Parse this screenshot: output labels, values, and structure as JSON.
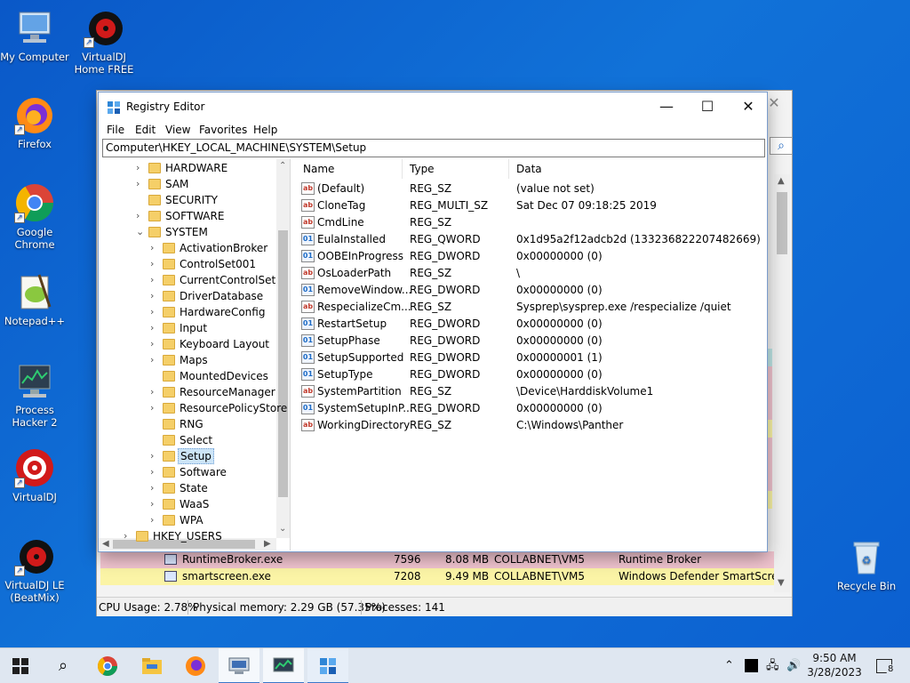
{
  "desktop_icons": [
    {
      "label": "My Computer",
      "icon": "my-computer-icon"
    },
    {
      "label": "VirtualDJ Home FREE",
      "icon": "virtualdj-home-icon"
    },
    {
      "label": "Firefox",
      "icon": "firefox-icon"
    },
    {
      "label": "Google Chrome",
      "icon": "chrome-icon"
    },
    {
      "label": "Notepad++",
      "icon": "notepadpp-icon"
    },
    {
      "label": "Process Hacker 2",
      "icon": "process-hacker-icon"
    },
    {
      "label": "VirtualDJ",
      "icon": "virtualdj-icon"
    },
    {
      "label": "VirtualDJ LE (BeatMix)",
      "icon": "virtualdj-le-icon"
    },
    {
      "label": "Recycle Bin",
      "icon": "recycle-bin-icon"
    }
  ],
  "registry": {
    "title": "Registry Editor",
    "menu": [
      "File",
      "Edit",
      "View",
      "Favorites",
      "Help"
    ],
    "address": "Computer\\HKEY_LOCAL_MACHINE\\SYSTEM\\Setup",
    "tree": [
      {
        "label": "HARDWARE",
        "expander": "›"
      },
      {
        "label": "SAM",
        "expander": "›"
      },
      {
        "label": "SECURITY",
        "expander": ""
      },
      {
        "label": "SOFTWARE",
        "expander": "›"
      },
      {
        "label": "SYSTEM",
        "expander": "⌄"
      },
      {
        "label": "ActivationBroker",
        "expander": "›"
      },
      {
        "label": "ControlSet001",
        "expander": "›"
      },
      {
        "label": "CurrentControlSet",
        "expander": "›"
      },
      {
        "label": "DriverDatabase",
        "expander": "›"
      },
      {
        "label": "HardwareConfig",
        "expander": "›"
      },
      {
        "label": "Input",
        "expander": "›"
      },
      {
        "label": "Keyboard Layout",
        "expander": "›"
      },
      {
        "label": "Maps",
        "expander": "›"
      },
      {
        "label": "MountedDevices",
        "expander": ""
      },
      {
        "label": "ResourceManager",
        "expander": "›"
      },
      {
        "label": "ResourcePolicyStore",
        "expander": "›"
      },
      {
        "label": "RNG",
        "expander": ""
      },
      {
        "label": "Select",
        "expander": ""
      },
      {
        "label": "Setup",
        "expander": "›"
      },
      {
        "label": "Software",
        "expander": "›"
      },
      {
        "label": "State",
        "expander": "›"
      },
      {
        "label": "WaaS",
        "expander": "›"
      },
      {
        "label": "WPA",
        "expander": "›"
      },
      {
        "label": "HKEY_USERS",
        "expander": "›"
      }
    ],
    "columns": {
      "name": "Name",
      "type": "Type",
      "data": "Data"
    },
    "values": [
      {
        "name": "(Default)",
        "type": "REG_SZ",
        "data": "(value not set)",
        "kind": "sz"
      },
      {
        "name": "CloneTag",
        "type": "REG_MULTI_SZ",
        "data": "Sat Dec 07 09:18:25 2019",
        "kind": "sz"
      },
      {
        "name": "CmdLine",
        "type": "REG_SZ",
        "data": "",
        "kind": "sz"
      },
      {
        "name": "EulaInstalled",
        "type": "REG_QWORD",
        "data": "0x1d95a2f12adcb2d (133236822207482669)",
        "kind": "bin"
      },
      {
        "name": "OOBEInProgress",
        "type": "REG_DWORD",
        "data": "0x00000000 (0)",
        "kind": "bin"
      },
      {
        "name": "OsLoaderPath",
        "type": "REG_SZ",
        "data": "\\",
        "kind": "sz"
      },
      {
        "name": "RemoveWindow...",
        "type": "REG_DWORD",
        "data": "0x00000000 (0)",
        "kind": "bin"
      },
      {
        "name": "RespecializeCm...",
        "type": "REG_SZ",
        "data": "Sysprep\\sysprep.exe /respecialize /quiet",
        "kind": "sz"
      },
      {
        "name": "RestartSetup",
        "type": "REG_DWORD",
        "data": "0x00000000 (0)",
        "kind": "bin"
      },
      {
        "name": "SetupPhase",
        "type": "REG_DWORD",
        "data": "0x00000000 (0)",
        "kind": "bin"
      },
      {
        "name": "SetupSupported",
        "type": "REG_DWORD",
        "data": "0x00000001 (1)",
        "kind": "bin"
      },
      {
        "name": "SetupType",
        "type": "REG_DWORD",
        "data": "0x00000000 (0)",
        "kind": "bin"
      },
      {
        "name": "SystemPartition",
        "type": "REG_SZ",
        "data": "\\Device\\HarddiskVolume1",
        "kind": "sz"
      },
      {
        "name": "SystemSetupInP...",
        "type": "REG_DWORD",
        "data": "0x00000000 (0)",
        "kind": "bin"
      },
      {
        "name": "WorkingDirectory",
        "type": "REG_SZ",
        "data": "C:\\Windows\\Panther",
        "kind": "sz"
      }
    ]
  },
  "process_hacker": {
    "rows": [
      {
        "name": "RuntimeBroker.exe",
        "pid": "7596",
        "mem": "8.08 MB",
        "user": "COLLABNET\\VM5",
        "desc": "Runtime Broker",
        "color": "#f1c4cf"
      },
      {
        "name": "smartscreen.exe",
        "pid": "7208",
        "mem": "9.49 MB",
        "user": "COLLABNET\\VM5",
        "desc": "Windows Defender SmartScre...",
        "color": "#fbf4a6"
      }
    ],
    "status": {
      "cpu": "CPU Usage: 2.78%",
      "memory": "Physical memory: 2.29 GB (57.35%)",
      "processes": "Processes: 141"
    }
  },
  "taskbar": {
    "time": "9:50 AM",
    "date": "3/28/2023",
    "notification_count": "8"
  },
  "colors": {
    "accent": "#0078d7",
    "selection": "#cce4f7"
  }
}
